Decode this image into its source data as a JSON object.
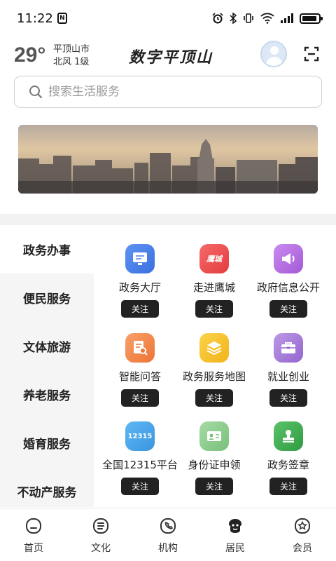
{
  "status_bar": {
    "time": "11:22",
    "nfc_label": "N",
    "icons": [
      "alarm-icon",
      "bluetooth-icon",
      "vibrate-icon",
      "wifi-icon",
      "signal-icon",
      "battery-icon"
    ]
  },
  "header": {
    "temperature": "29°",
    "city": "平顶山市",
    "wind": "北风  1级",
    "title": "数字平顶山",
    "avatar_icon": "user-avatar-icon",
    "scan_icon": "scan-icon"
  },
  "search": {
    "placeholder": "搜索生活服务",
    "icon": "search-icon"
  },
  "side_menu": {
    "items": [
      {
        "label": "政务办事",
        "active": true
      },
      {
        "label": "便民服务",
        "active": false
      },
      {
        "label": "文体旅游",
        "active": false
      },
      {
        "label": "养老服务",
        "active": false
      },
      {
        "label": "婚育服务",
        "active": false
      },
      {
        "label": "不动产服务",
        "active": false
      }
    ]
  },
  "services": [
    {
      "label": "政务大厅",
      "icon": "monitor-icon",
      "color": "#4a7fe8",
      "button": "关注"
    },
    {
      "label": "走进鹰城",
      "icon": "yingcheng-logo-icon",
      "icon_text": "鹰城",
      "color": "#ee5052",
      "button": "关注"
    },
    {
      "label": "政府信息公开",
      "icon": "megaphone-icon",
      "color": "#b96de0",
      "button": "关注"
    },
    {
      "label": "智能问答",
      "icon": "document-search-icon",
      "color": "#f28a4a",
      "button": "关注"
    },
    {
      "label": "政务服务地图",
      "icon": "layers-icon",
      "color": "#f5c12e",
      "button": "关注"
    },
    {
      "label": "就业创业",
      "icon": "briefcase-icon",
      "color": "#a980d8",
      "button": "关注"
    },
    {
      "label": "全国12315平台",
      "icon": "hotline-12315-icon",
      "icon_text": "12315",
      "color": "#4aa8ec",
      "button": "关注"
    },
    {
      "label": "身份证申领",
      "icon": "id-card-icon",
      "color": "#84c984",
      "button": "关注"
    },
    {
      "label": "政务签章",
      "icon": "stamp-icon",
      "color": "#3fae4f",
      "button": "关注"
    }
  ],
  "bottom_nav": [
    {
      "label": "首页",
      "icon": "home-icon"
    },
    {
      "label": "文化",
      "icon": "culture-icon"
    },
    {
      "label": "机构",
      "icon": "phone-icon"
    },
    {
      "label": "居民",
      "icon": "resident-icon"
    },
    {
      "label": "会员",
      "icon": "member-star-icon"
    }
  ]
}
